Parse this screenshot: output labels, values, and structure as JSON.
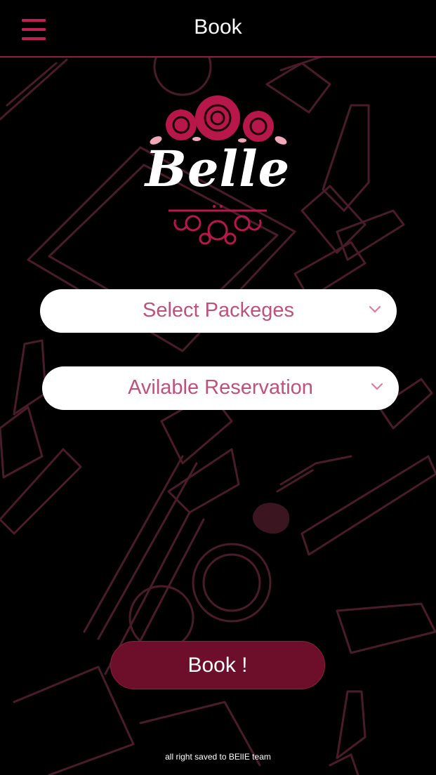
{
  "header": {
    "title": "Book"
  },
  "logo": {
    "text": "Belle"
  },
  "form": {
    "packages_label": "Select Packeges",
    "reservation_label": "Avilable Reservation",
    "book_label": "Book !"
  },
  "footer": {
    "text": "all right saved to BElIE team"
  },
  "colors": {
    "accent": "#c21f56",
    "button_bg": "#6d0f2a",
    "select_text": "#c0507c",
    "background": "#000000"
  },
  "icons": {
    "menu": "hamburger-icon",
    "dropdown": "chevron-down-icon"
  }
}
